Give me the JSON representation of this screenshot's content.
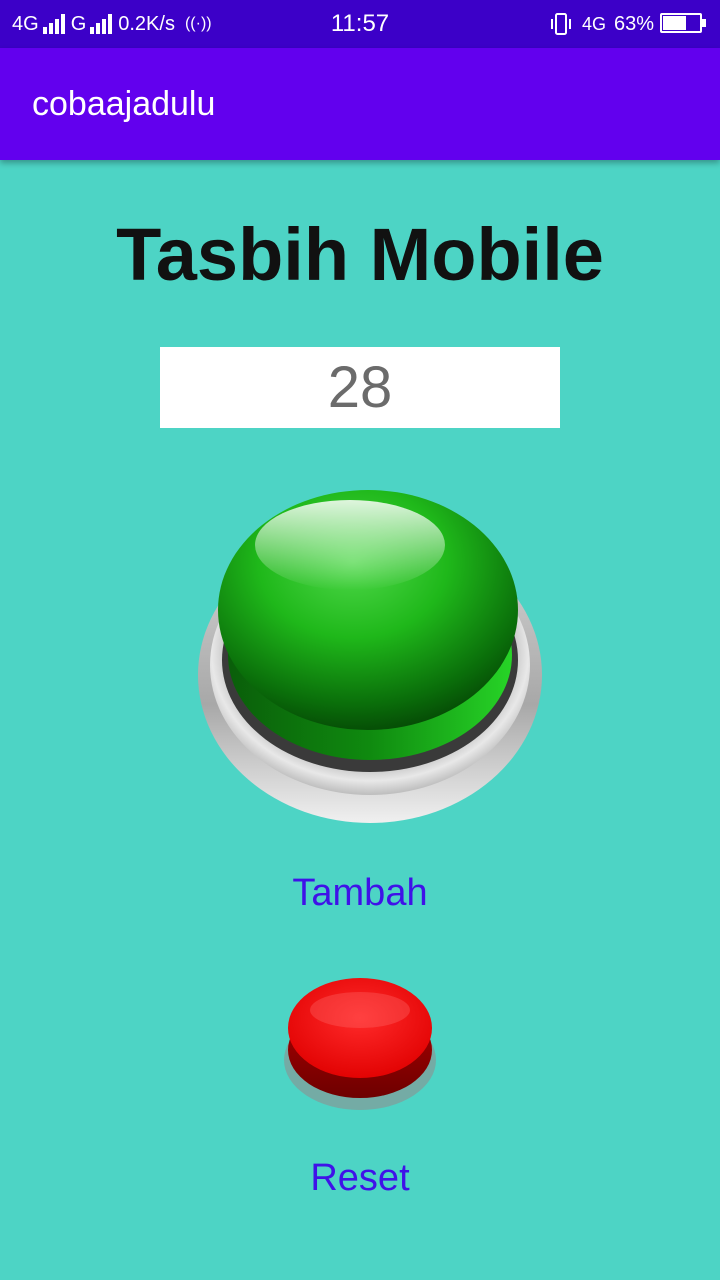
{
  "status_bar": {
    "network_left": "4G",
    "network_second": "G",
    "speed": "0.2K/s",
    "time": "11:57",
    "network_right": "4G",
    "battery_percent_text": "63%",
    "battery_level": 0.63
  },
  "app_bar": {
    "title": "cobaajadulu"
  },
  "main": {
    "title": "Tasbih Mobile",
    "counter": "28",
    "add_label": "Tambah",
    "reset_label": "Reset"
  },
  "colors": {
    "status_bar": "#3c00c8",
    "app_bar": "#6200ee",
    "background": "#4dd4c5",
    "button_label": "#3f12e8",
    "add_button": "#1fb81a",
    "reset_button": "#ff0000"
  }
}
